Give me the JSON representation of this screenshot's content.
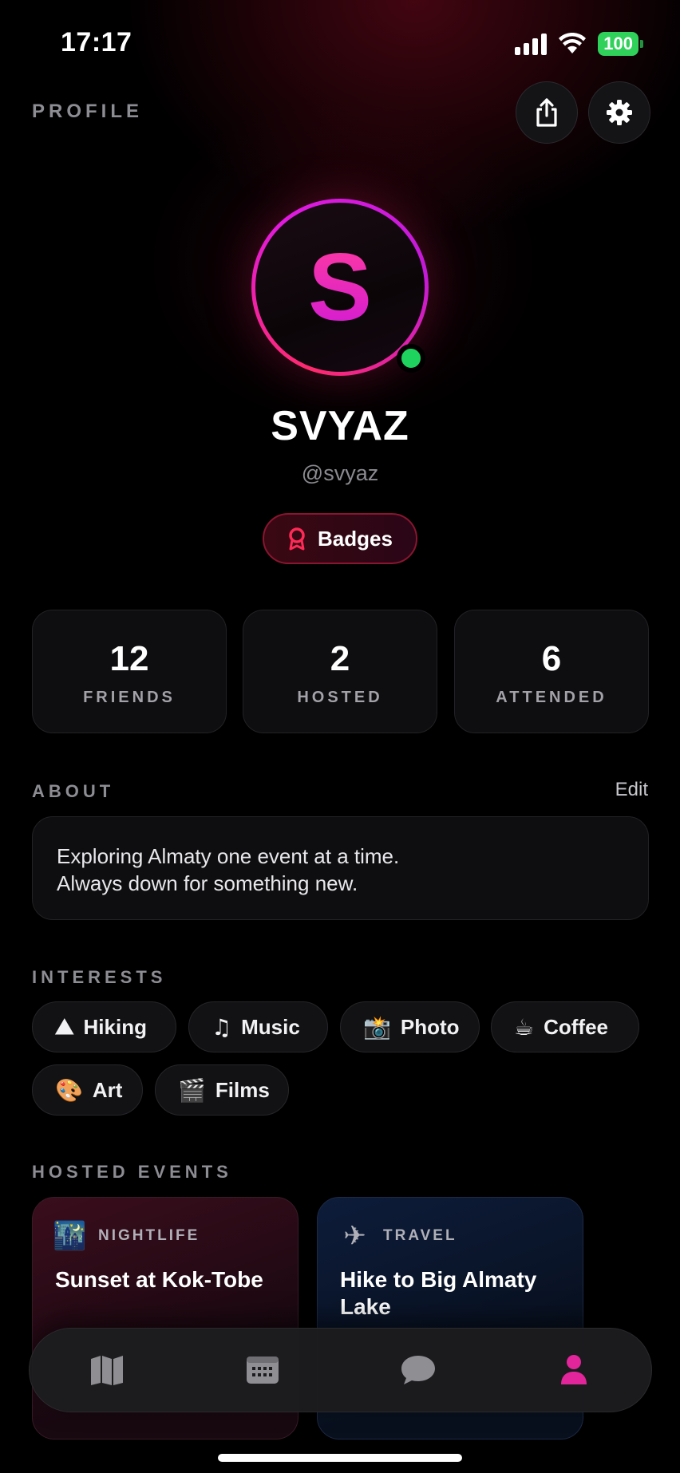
{
  "status_bar": {
    "time": "17:17",
    "battery": "100"
  },
  "header": {
    "title": "PROFILE",
    "share_icon": "share-icon",
    "settings_icon": "gear-icon"
  },
  "profile": {
    "avatar_letter": "S",
    "name": "SVYAZ",
    "handle": "@svyaz",
    "badges_label": "Badges",
    "online": true
  },
  "stats": [
    {
      "value": "12",
      "label": "FRIENDS"
    },
    {
      "value": "2",
      "label": "HOSTED"
    },
    {
      "value": "6",
      "label": "ATTENDED"
    }
  ],
  "about": {
    "label": "ABOUT",
    "edit_label": "Edit",
    "lines": [
      "Exploring Almaty one event at a time.",
      "Always down for something new."
    ]
  },
  "interests": {
    "label": "INTERESTS",
    "items": [
      {
        "emoji": "⛰",
        "label": "Hiking"
      },
      {
        "emoji": "♫",
        "label": "Music"
      },
      {
        "emoji": "📸",
        "label": "Photo"
      },
      {
        "emoji": "☕",
        "label": "Coffee"
      },
      {
        "emoji": "🎨",
        "label": "Art"
      },
      {
        "emoji": "🎬",
        "label": "Films"
      }
    ]
  },
  "hosted_events": {
    "label": "HOSTED EVENTS",
    "items": [
      {
        "category": "NIGHTLIFE",
        "icon": "🌃",
        "title": "Sunset at Kok-Tobe"
      },
      {
        "category": "TRAVEL",
        "icon": "✈",
        "title": "Hike to Big Almaty Lake"
      }
    ]
  },
  "tab_bar": {
    "items": [
      "map-icon",
      "calendar-icon",
      "chat-icon",
      "profile-icon"
    ],
    "active": "profile-icon",
    "colors": {
      "active": "#e3259b",
      "inactive": "#8e8e93"
    }
  },
  "colors": {
    "accent": "#ff2a6d",
    "online": "#1fd35f"
  }
}
